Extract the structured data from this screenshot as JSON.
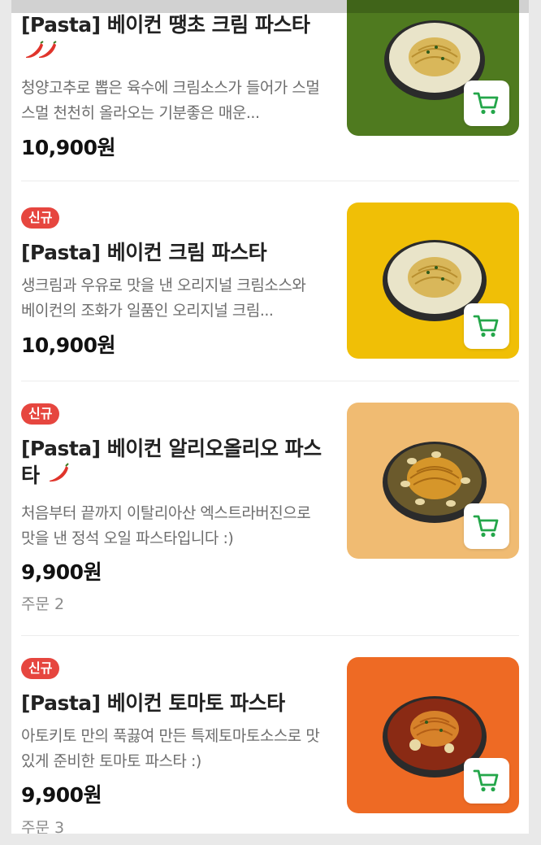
{
  "colors": {
    "accent_badge": "#e6463f",
    "cart_icon": "#24a64a",
    "thumb_bg": [
      "#4f7a1f",
      "#f0bf06",
      "#f0bb72",
      "#ee6a24"
    ]
  },
  "items": [
    {
      "badge": "",
      "title": "[Pasta] 베이컨 땡초 크림 파스타",
      "spicy_level": 2,
      "desc": "청양고추로 뽑은 육수에 크림소스가 들어가 스멀스멀 천천히 올라오는 기분좋은 매운...",
      "price": "10,900원",
      "orders": "",
      "thumb_icon": "cream-pasta-dish-icon"
    },
    {
      "badge": "신규",
      "title": "[Pasta] 베이컨 크림 파스타",
      "spicy_level": 0,
      "desc": "생크림과 우유로 맛을 낸 오리지널 크림소스와 베이컨의 조화가 일품인 오리지널 크림...",
      "price": "10,900원",
      "orders": "",
      "thumb_icon": "cream-pasta-dish-icon"
    },
    {
      "badge": "신규",
      "title": "[Pasta] 베이컨 알리오올리오 파스타",
      "spicy_level": 1,
      "desc": "처음부터 끝까지 이탈리아산 엑스트라버진으로 맛을 낸 정석 오일 파스타입니다 :)",
      "price": "9,900원",
      "orders": "주문 2",
      "thumb_icon": "oil-pasta-dish-icon"
    },
    {
      "badge": "신규",
      "title": "[Pasta] 베이컨 토마토 파스타",
      "spicy_level": 0,
      "desc": "아토키토 만의 푹끓여 만든 특제토마토소스로 맛있게 준비한 토마토 파스타 :)",
      "price": "9,900원",
      "orders": "주문 3",
      "thumb_icon": "tomato-pasta-dish-icon"
    }
  ]
}
